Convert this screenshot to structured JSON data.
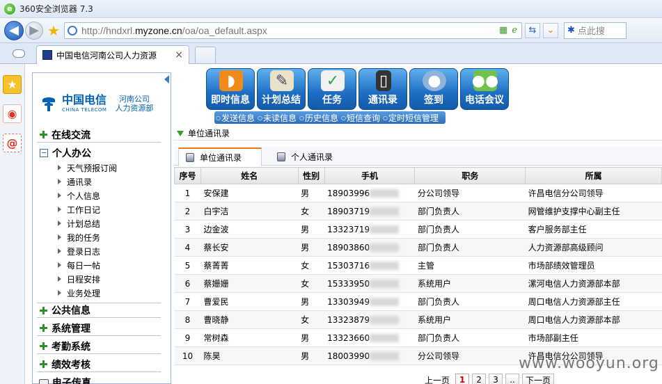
{
  "browser": {
    "title": "360安全浏览器 7.3",
    "url_prefix": "http://hndxrl.",
    "url_domain": "myzone.cn",
    "url_path": "/oa/oa_default.aspx",
    "search_placeholder": "点此搜",
    "tab_title": "中国电信河南公司人力资源",
    "tab_close": "×"
  },
  "brand": {
    "name_cn": "中国电信",
    "name_en": "CHINA TELECOM",
    "branch_line1": "河南公司",
    "branch_line2": "人力资源部",
    "color": "#0060b4"
  },
  "leftnav": {
    "sections": [
      {
        "label": "在线交流"
      },
      {
        "label": "个人办公"
      },
      {
        "label": "公共信息"
      },
      {
        "label": "系统管理"
      },
      {
        "label": "考勤系统"
      },
      {
        "label": "绩效考核"
      },
      {
        "label": "电子传真"
      }
    ],
    "personal_items": [
      "天气预报订阅",
      "通讯录",
      "个人信息",
      "工作日记",
      "计划总结",
      "我的任务",
      "登录日志",
      "每日一帖",
      "日程安排",
      "业务处理"
    ]
  },
  "toolbar": {
    "buttons": [
      {
        "label": "即时信息",
        "icon": "rss-icon"
      },
      {
        "label": "计划总结",
        "icon": "clipboard-icon"
      },
      {
        "label": "任务",
        "icon": "notepad-icon"
      },
      {
        "label": "通讯录",
        "icon": "phone-icon"
      },
      {
        "label": "签到",
        "icon": "user-icon"
      },
      {
        "label": "电话会议",
        "icon": "group-icon"
      }
    ],
    "sub_links": [
      "发送信息",
      "未读信息",
      "历史信息",
      "短信查询",
      "定时短信管理"
    ]
  },
  "main": {
    "breadcrumb": "单位通讯录",
    "tabs": [
      {
        "label": "单位通讯录"
      },
      {
        "label": "个人通讯录"
      }
    ],
    "columns": [
      "序号",
      "姓名",
      "性别",
      "手机",
      "职务",
      "所属"
    ],
    "rows": [
      {
        "no": "1",
        "name": "安保建",
        "gender": "男",
        "phone": "18903996",
        "title": "分公司领导",
        "unit": "许昌电信分公司领导"
      },
      {
        "no": "2",
        "name": "白宇洁",
        "gender": "女",
        "phone": "18903719",
        "title": "部门负责人",
        "unit": "网管维护支撑中心副主任"
      },
      {
        "no": "3",
        "name": "边金波",
        "gender": "男",
        "phone": "13323719",
        "title": "部门负责人",
        "unit": "客户服务部主任"
      },
      {
        "no": "4",
        "name": "蔡长安",
        "gender": "男",
        "phone": "18903860",
        "title": "部门负责人",
        "unit": "人力资源部高级顾问"
      },
      {
        "no": "5",
        "name": "蔡菁菁",
        "gender": "女",
        "phone": "15303716",
        "title": "主管",
        "unit": "市场部绩效管理员"
      },
      {
        "no": "6",
        "name": "蔡姗姗",
        "gender": "女",
        "phone": "15333950",
        "title": "系统用户",
        "unit": "漯河电信人力资源部本部"
      },
      {
        "no": "7",
        "name": "曹爱民",
        "gender": "男",
        "phone": "13303949",
        "title": "部门负责人",
        "unit": "周口电信人力资源部主任"
      },
      {
        "no": "8",
        "name": "曹晓静",
        "gender": "女",
        "phone": "13323879",
        "title": "系统用户",
        "unit": "周口电信人力资源部本部"
      },
      {
        "no": "9",
        "name": "常树森",
        "gender": "男",
        "phone": "13323660",
        "title": "部门负责人",
        "unit": "市场部副主任"
      },
      {
        "no": "10",
        "name": "陈昊",
        "gender": "男",
        "phone": "18003990",
        "title": "分公司领导",
        "unit": "许昌电信分公司领导"
      }
    ],
    "pager": {
      "prev": "上一页",
      "pages": [
        "1",
        "2",
        "3"
      ],
      "ellipsis": "..",
      "next": "下一页",
      "current": "1"
    }
  },
  "watermark": "www.wooyun.org"
}
